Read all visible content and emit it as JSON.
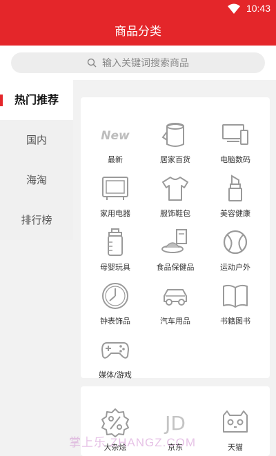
{
  "status": {
    "time": "10:43",
    "wifi_icon": "wifi-icon"
  },
  "header": {
    "title": "商品分类"
  },
  "search": {
    "placeholder": "输入关键词搜索商品",
    "icon": "search-icon"
  },
  "sidebar": {
    "items": [
      {
        "label": "热门推荐",
        "active": true
      },
      {
        "label": "国内",
        "active": false
      },
      {
        "label": "海淘",
        "active": false
      },
      {
        "label": "排行榜",
        "active": false
      }
    ]
  },
  "categories": [
    {
      "label": "最新",
      "icon": "new-icon"
    },
    {
      "label": "居家百货",
      "icon": "tissue-roll-icon"
    },
    {
      "label": "电脑数码",
      "icon": "devices-icon"
    },
    {
      "label": "家用电器",
      "icon": "tv-icon"
    },
    {
      "label": "服饰鞋包",
      "icon": "tshirt-icon"
    },
    {
      "label": "美容健康",
      "icon": "lipstick-icon"
    },
    {
      "label": "母婴玩具",
      "icon": "baby-bottle-icon"
    },
    {
      "label": "食品保健品",
      "icon": "food-icon"
    },
    {
      "label": "运动户外",
      "icon": "ball-icon"
    },
    {
      "label": "钟表饰品",
      "icon": "clock-icon"
    },
    {
      "label": "汽车用品",
      "icon": "car-icon"
    },
    {
      "label": "书籍图书",
      "icon": "book-icon"
    },
    {
      "label": "媒体/游戏",
      "icon": "gamepad-icon"
    }
  ],
  "shops": [
    {
      "label": "大杂烩",
      "icon": "percent-badge-icon"
    },
    {
      "label": "京东",
      "icon": "jd-logo-icon",
      "logo_text": "JD"
    },
    {
      "label": "天猫",
      "icon": "tmall-icon"
    }
  ],
  "watermark": "掌上乐 ZHANGZ.COM",
  "colors": {
    "accent": "#e4262a",
    "icon_gray": "#9a9a9a"
  }
}
